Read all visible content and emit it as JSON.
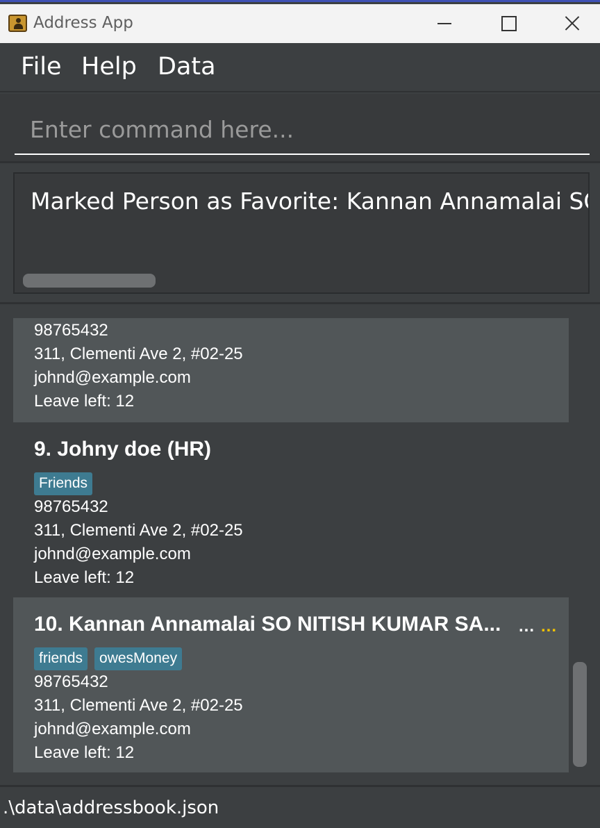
{
  "window": {
    "title": "Address App"
  },
  "menu": {
    "file": "File",
    "help": "Help",
    "data": "Data"
  },
  "command": {
    "placeholder": "Enter command here..."
  },
  "result": {
    "text": "Marked Person as Favorite: Kannan Annamalai SO NITISH KUMAR SA"
  },
  "persons": [
    {
      "phone": "98765432",
      "address": "311, Clementi Ave 2, #02-25",
      "email": "johnd@example.com",
      "leave": "Leave left: 12"
    },
    {
      "name": "9. Johny doe (HR)",
      "tags": [
        "Friends"
      ],
      "phone": "98765432",
      "address": "311, Clementi Ave 2, #02-25",
      "email": "johnd@example.com",
      "leave": "Leave left: 12"
    },
    {
      "name": "10. Kannan Annamalai SO NITISH KUMAR SA...",
      "truncation": "...",
      "favorite": "...",
      "tags": [
        "friends",
        "owesMoney"
      ],
      "phone": "98765432",
      "address": "311, Clementi Ave 2, #02-25",
      "email": "johnd@example.com",
      "leave": "Leave left: 12"
    }
  ],
  "status": {
    "path": ".\\data\\addressbook.json"
  },
  "colors": {
    "tag": "#3e7b91",
    "favorite": "#f2c200",
    "card_light": "#515658",
    "card_dark": "#3c3f41"
  }
}
